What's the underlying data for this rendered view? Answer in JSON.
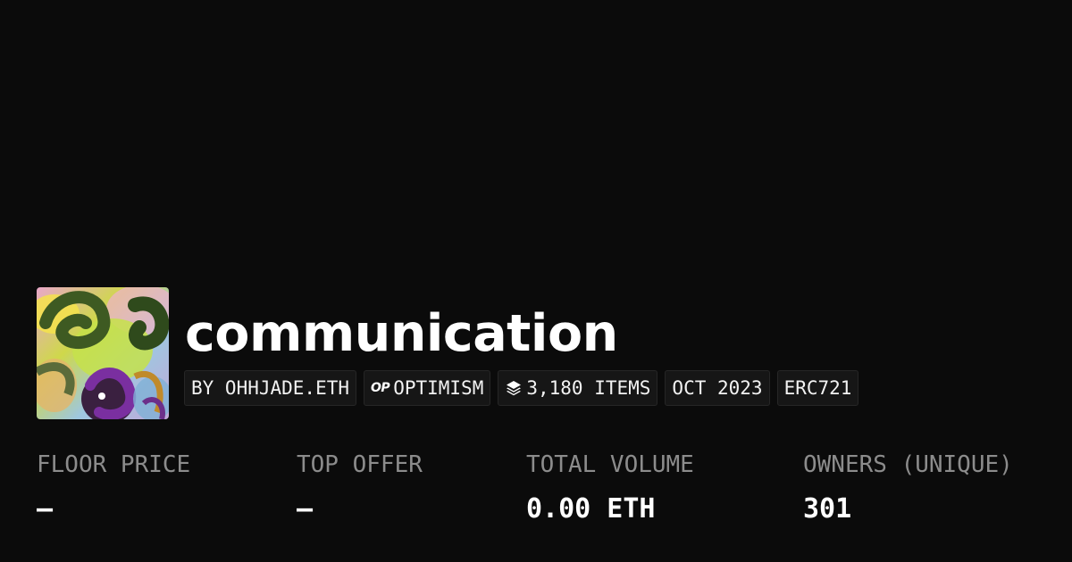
{
  "collection": {
    "name": "communication",
    "avatar_icon": "collection-artwork"
  },
  "tags": {
    "creator": "BY OHHJADE.ETH",
    "chain_logo": "OP",
    "chain": "OPTIMISM",
    "items_icon": "layers-icon",
    "items": "3,180 ITEMS",
    "date": "OCT 2023",
    "standard": "ERC721"
  },
  "stats": {
    "floor_price": {
      "label": "FLOOR PRICE",
      "value": "–"
    },
    "top_offer": {
      "label": "TOP OFFER",
      "value": "–"
    },
    "total_volume": {
      "label": "TOTAL VOLUME",
      "value": "0.00 ETH"
    },
    "owners": {
      "label": "OWNERS (UNIQUE)",
      "value": "301"
    }
  },
  "colors": {
    "background": "#0b0b0b",
    "tag_background": "#161616",
    "label": "#8c8c8c",
    "text": "#ffffff"
  }
}
